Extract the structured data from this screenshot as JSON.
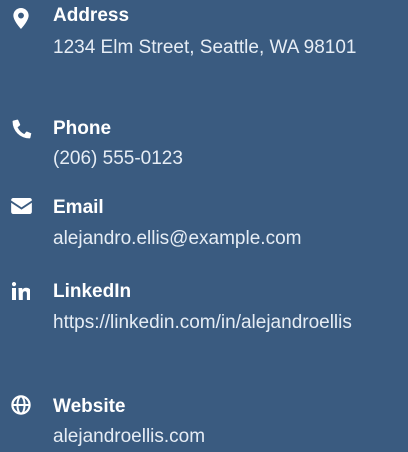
{
  "contacts": {
    "address": {
      "label": "Address",
      "value": "1234 Elm Street, Seattle, WA 98101",
      "icon": "map-pin-icon"
    },
    "phone": {
      "label": "Phone",
      "value": "(206) 555-0123",
      "icon": "phone-icon"
    },
    "email": {
      "label": "Email",
      "value": "alejandro.ellis@example.com",
      "icon": "envelope-icon"
    },
    "linkedin": {
      "label": "LinkedIn",
      "value": "https://linkedin.com/in/alejandroellis",
      "icon": "linkedin-icon"
    },
    "website": {
      "label": "Website",
      "value": "alejandroellis.com",
      "icon": "globe-icon"
    }
  },
  "colors": {
    "background": "#3a5b80",
    "text": "#ffffff"
  }
}
